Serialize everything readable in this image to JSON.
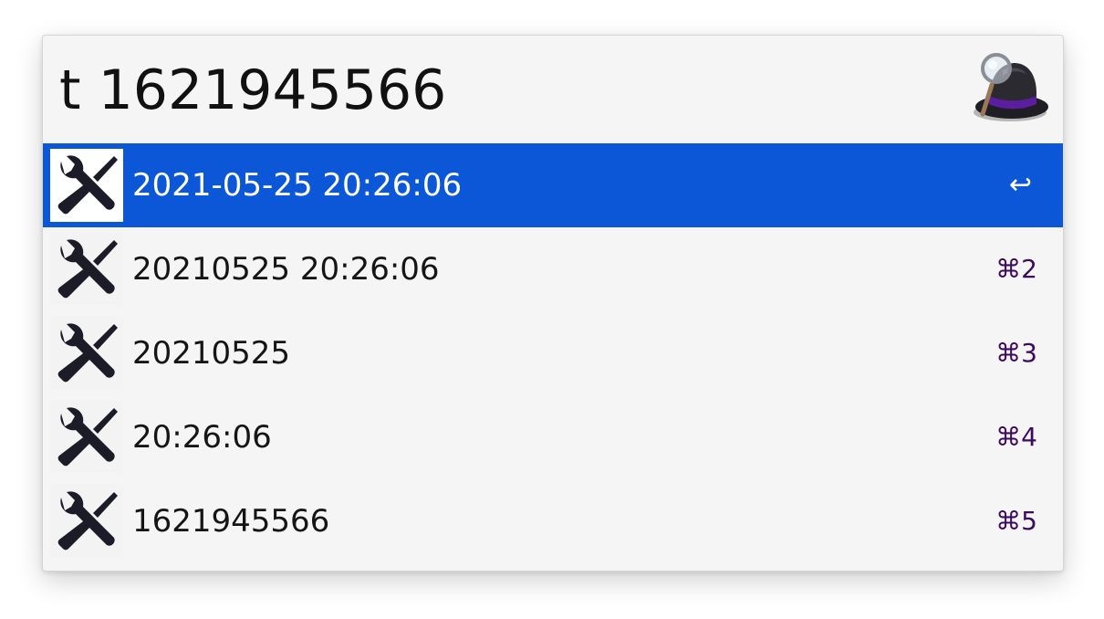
{
  "search": {
    "query": "t 1621945566"
  },
  "app": {
    "logo_icon": "bowler-hat-magnifier-icon"
  },
  "colors": {
    "selection": "#0b57d8",
    "shortcut": "#3c0a5e",
    "background": "#f5f5f5"
  },
  "results": [
    {
      "title": "2021-05-25 20:26:06",
      "shortcut": "↩",
      "icon": "tools-icon",
      "selected": true
    },
    {
      "title": "20210525 20:26:06",
      "shortcut": "⌘2",
      "icon": "tools-icon",
      "selected": false
    },
    {
      "title": "20210525",
      "shortcut": "⌘3",
      "icon": "tools-icon",
      "selected": false
    },
    {
      "title": "20:26:06",
      "shortcut": "⌘4",
      "icon": "tools-icon",
      "selected": false
    },
    {
      "title": "1621945566",
      "shortcut": "⌘5",
      "icon": "tools-icon",
      "selected": false
    }
  ]
}
